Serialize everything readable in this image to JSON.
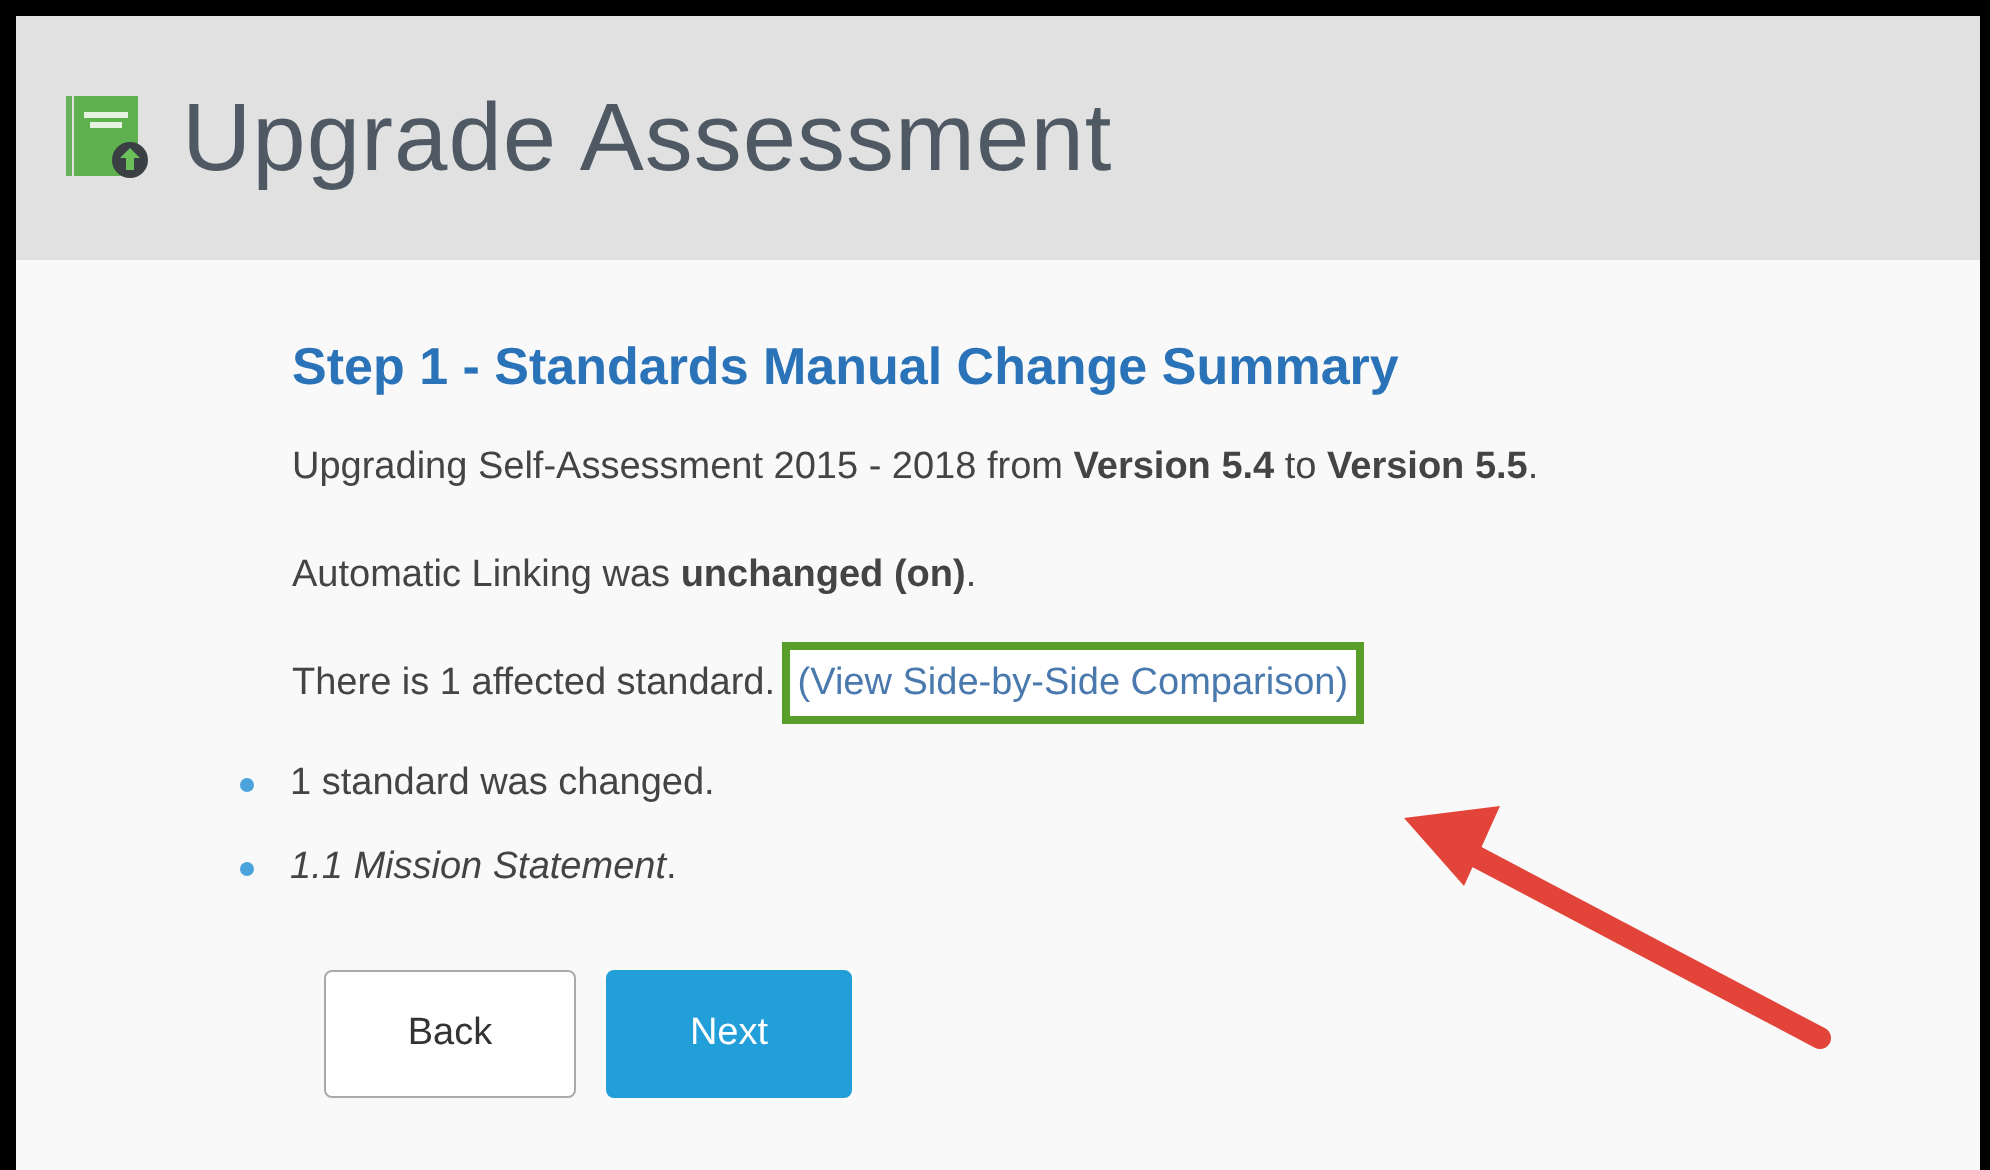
{
  "window": {
    "title": "Upgrade Assessment"
  },
  "step": {
    "heading": "Step 1 - Standards Manual Change Summary",
    "paragraphs": [
      {
        "text": "Upgrading Self-Assessment 2015 - 2018 from **Version 5.4** to **Version 5.5**."
      },
      {
        "text": "Automatic Linking was **unchanged (on)**."
      },
      {
        "text": "There is 1 affected standard. ",
        "link": {
          "label": "(View Side-by-Side Comparison)",
          "highlighted": true
        }
      }
    ],
    "bullets": [
      "1 standard was changed.",
      "*1.1 Mission Statement*."
    ]
  },
  "buttons": [
    {
      "label": "Back",
      "kind": "secondary"
    },
    {
      "label": "Next",
      "kind": "primary"
    }
  ]
}
